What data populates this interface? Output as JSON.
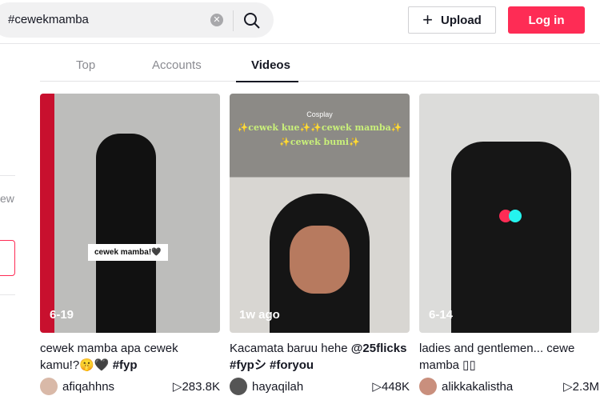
{
  "search": {
    "value": "#cewekmamba"
  },
  "header": {
    "upload_label": "Upload",
    "login_label": "Log in"
  },
  "tabs": [
    {
      "label": "Top"
    },
    {
      "label": "Accounts"
    },
    {
      "label": "Videos",
      "active": true
    }
  ],
  "sidebar": {
    "partial_text": "ew"
  },
  "accent": "#fe2c55",
  "videos": [
    {
      "date": "6-19",
      "overlay": "cewek mamba!🖤",
      "desc_plain": "cewek mamba apa cewek kamu!?🤫🖤 ",
      "desc_tag": "#fyp",
      "user": "afiqahhns",
      "views": "283.8K"
    },
    {
      "date": "1w ago",
      "overlay_label": "Cosplay",
      "overlay": "✨cewek kue✨✨cewek mamba✨",
      "overlay2": "✨cewek bumi✨",
      "desc_plain": "Kacamata baruu hehe ",
      "desc_tag": "@25flicks #fypシ #foryou",
      "user": "hayaqilah",
      "views": "448K"
    },
    {
      "date": "6-14",
      "desc_plain": "ladies and gentlemen... cewe mamba ▯▯",
      "desc_tag": "",
      "user": "alikkakalistha",
      "views": "2.3M"
    }
  ]
}
